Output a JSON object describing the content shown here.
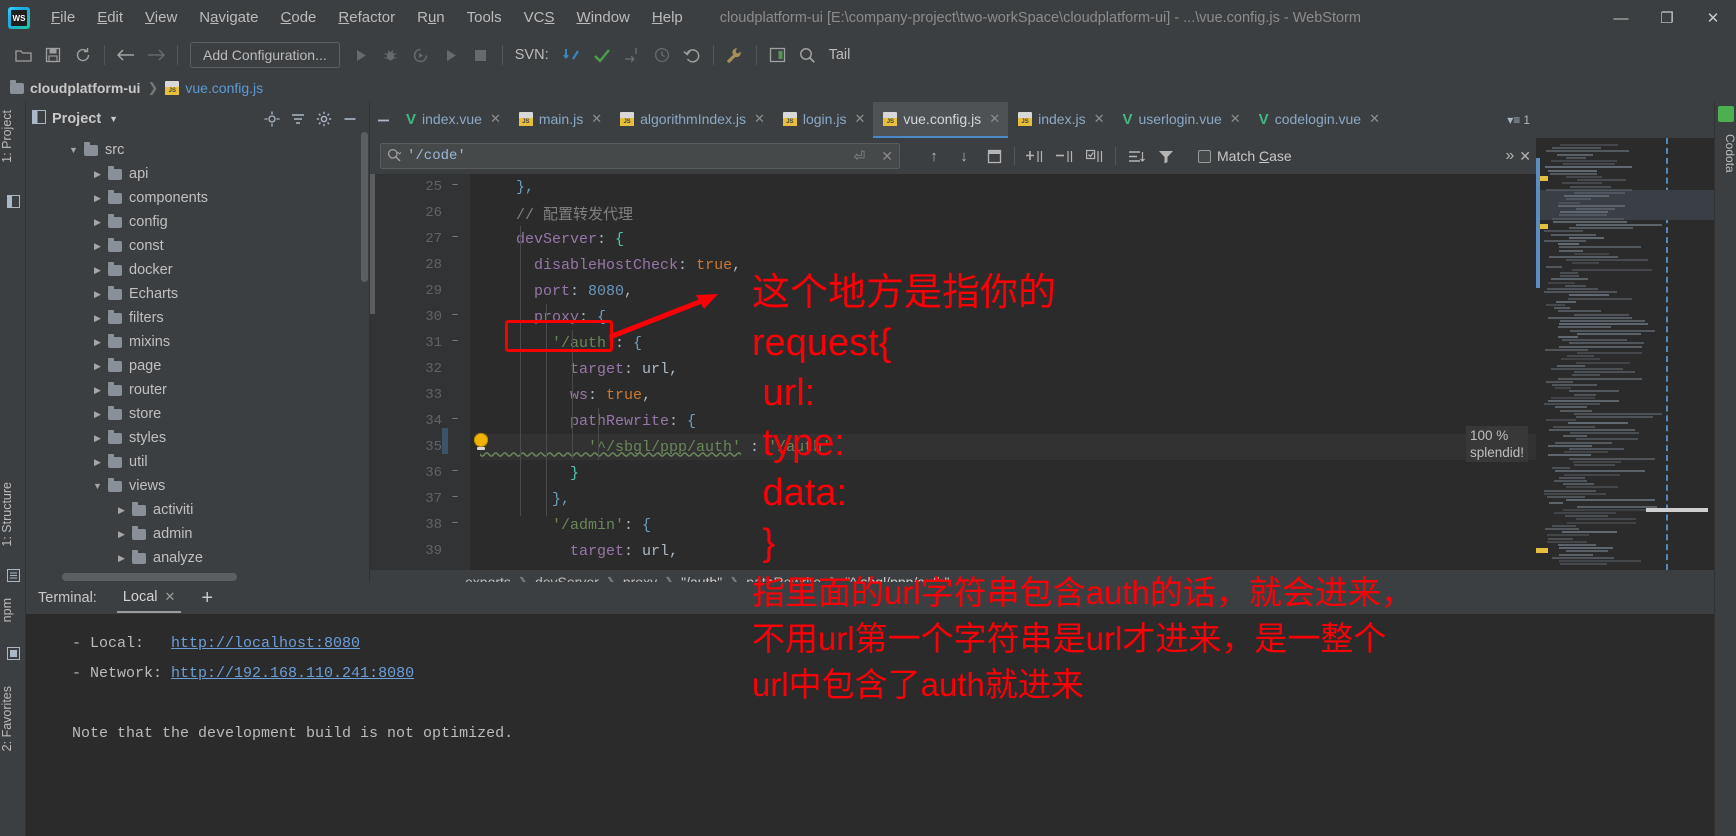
{
  "window": {
    "title": "cloudplatform-ui [E:\\company-project\\two-workSpace\\cloudplatform-ui] - ...\\vue.config.js - WebStorm",
    "minimize": "—",
    "maximize": "❐",
    "close": "✕"
  },
  "menu": [
    {
      "label": "File"
    },
    {
      "label": "Edit"
    },
    {
      "label": "View"
    },
    {
      "label": "Navigate"
    },
    {
      "label": "Code"
    },
    {
      "label": "Refactor"
    },
    {
      "label": "Run"
    },
    {
      "label": "Tools"
    },
    {
      "label": "VCS"
    },
    {
      "label": "Window"
    },
    {
      "label": "Help"
    }
  ],
  "toolbar": {
    "add_configuration": "Add Configuration...",
    "svn_label": "SVN:",
    "tail_label": "Tail"
  },
  "pathbar": {
    "project": "cloudplatform-ui",
    "file": "vue.config.js",
    "separator": "❯"
  },
  "left_strip": {
    "project_tab": "1: Project",
    "structure_tab": "1: Structure",
    "npm_tab": "npm",
    "favorites_tab": "2: Favorites"
  },
  "right_strip": {
    "codota_tab": "Codota"
  },
  "project_panel": {
    "title": "Project",
    "tree": [
      {
        "label": "src",
        "depth": 1,
        "twisty": "open",
        "type": "folder"
      },
      {
        "label": "api",
        "depth": 2,
        "twisty": "closed",
        "type": "folder"
      },
      {
        "label": "components",
        "depth": 2,
        "twisty": "closed",
        "type": "folder"
      },
      {
        "label": "config",
        "depth": 2,
        "twisty": "closed",
        "type": "folder"
      },
      {
        "label": "const",
        "depth": 2,
        "twisty": "closed",
        "type": "folder"
      },
      {
        "label": "docker",
        "depth": 2,
        "twisty": "closed",
        "type": "folder"
      },
      {
        "label": "Echarts",
        "depth": 2,
        "twisty": "closed",
        "type": "folder"
      },
      {
        "label": "filters",
        "depth": 2,
        "twisty": "closed",
        "type": "folder"
      },
      {
        "label": "mixins",
        "depth": 2,
        "twisty": "closed",
        "type": "folder"
      },
      {
        "label": "page",
        "depth": 2,
        "twisty": "closed",
        "type": "folder"
      },
      {
        "label": "router",
        "depth": 2,
        "twisty": "closed",
        "type": "folder"
      },
      {
        "label": "store",
        "depth": 2,
        "twisty": "closed",
        "type": "folder"
      },
      {
        "label": "styles",
        "depth": 2,
        "twisty": "closed",
        "type": "folder"
      },
      {
        "label": "util",
        "depth": 2,
        "twisty": "closed",
        "type": "folder"
      },
      {
        "label": "views",
        "depth": 2,
        "twisty": "open",
        "type": "folder"
      },
      {
        "label": "activiti",
        "depth": 3,
        "twisty": "closed",
        "type": "folder"
      },
      {
        "label": "admin",
        "depth": 3,
        "twisty": "closed",
        "type": "folder"
      },
      {
        "label": "analyze",
        "depth": 3,
        "twisty": "closed",
        "type": "folder"
      }
    ]
  },
  "tabs": [
    {
      "label": "index.vue",
      "icon": "vue-icon",
      "active": false
    },
    {
      "label": "main.js",
      "icon": "js-icon",
      "active": false
    },
    {
      "label": "algorithmIndex.js",
      "icon": "js-icon",
      "active": false
    },
    {
      "label": "login.js",
      "icon": "js-icon",
      "active": false
    },
    {
      "label": "vue.config.js",
      "icon": "js-icon",
      "active": true
    },
    {
      "label": "index.js",
      "icon": "js-icon",
      "active": false
    },
    {
      "label": "userlogin.vue",
      "icon": "vue-icon",
      "active": false
    },
    {
      "label": "codelogin.vue",
      "icon": "vue-icon",
      "active": false
    }
  ],
  "tab_overflow": "1",
  "find": {
    "value": "'/code'",
    "placeholder": "Search",
    "match_case_label": "Match Case",
    "match_case_checked": false,
    "more_label": "»"
  },
  "editor": {
    "first_line": 25,
    "highlight_line": 35,
    "tooltip": {
      "percent": "100 %",
      "word": "splendid!"
    },
    "lines": [
      {
        "n": 25,
        "fold": "−",
        "tokens": [
          {
            "t": "    },",
            "c": "k-brace1"
          }
        ]
      },
      {
        "n": 26,
        "fold": "",
        "tokens": [
          {
            "t": "    // 配置转发代理",
            "c": "k-comment"
          }
        ]
      },
      {
        "n": 27,
        "fold": "−",
        "tokens": [
          {
            "t": "    devServer",
            "c": "k-key"
          },
          {
            "t": ": ",
            "c": "k-punc"
          },
          {
            "t": "{",
            "c": "k-brace2"
          }
        ]
      },
      {
        "n": 28,
        "fold": "",
        "tokens": [
          {
            "t": "      disableHostCheck",
            "c": "k-key"
          },
          {
            "t": ": ",
            "c": "k-punc"
          },
          {
            "t": "true",
            "c": "k-bool"
          },
          {
            "t": ",",
            "c": "k-punc"
          }
        ]
      },
      {
        "n": 29,
        "fold": "",
        "tokens": [
          {
            "t": "      port",
            "c": "k-key"
          },
          {
            "t": ": ",
            "c": "k-punc"
          },
          {
            "t": "8080",
            "c": "k-num"
          },
          {
            "t": ",",
            "c": "k-punc"
          }
        ]
      },
      {
        "n": 30,
        "fold": "−",
        "tokens": [
          {
            "t": "      proxy",
            "c": "k-key"
          },
          {
            "t": ": ",
            "c": "k-punc"
          },
          {
            "t": "{",
            "c": "k-brace1"
          }
        ]
      },
      {
        "n": 31,
        "fold": "−",
        "tokens": [
          {
            "t": "        '/auth'",
            "c": "k-str"
          },
          {
            "t": ": ",
            "c": "k-punc"
          },
          {
            "t": "{",
            "c": "k-brace1"
          }
        ]
      },
      {
        "n": 32,
        "fold": "",
        "tokens": [
          {
            "t": "          target",
            "c": "k-key"
          },
          {
            "t": ": ",
            "c": "k-punc"
          },
          {
            "t": "url",
            "c": "k-plain"
          },
          {
            "t": ",",
            "c": "k-punc"
          }
        ]
      },
      {
        "n": 33,
        "fold": "",
        "tokens": [
          {
            "t": "          ws",
            "c": "k-key"
          },
          {
            "t": ": ",
            "c": "k-punc"
          },
          {
            "t": "true",
            "c": "k-bool"
          },
          {
            "t": ",",
            "c": "k-punc"
          }
        ]
      },
      {
        "n": 34,
        "fold": "−",
        "tokens": [
          {
            "t": "          pathRewrite",
            "c": "k-key"
          },
          {
            "t": ": ",
            "c": "k-punc"
          },
          {
            "t": "{",
            "c": "k-brace1"
          }
        ]
      },
      {
        "n": 35,
        "fold": "",
        "tokens": [
          {
            "t": "            '^/sbgl/ppp/auth'",
            "c": "k-str"
          },
          {
            "t": " : ",
            "c": "k-punc"
          },
          {
            "t": "'/auth'",
            "c": "k-str"
          }
        ]
      },
      {
        "n": 36,
        "fold": "−",
        "tokens": [
          {
            "t": "          }",
            "c": "k-brace2"
          }
        ]
      },
      {
        "n": 37,
        "fold": "−",
        "tokens": [
          {
            "t": "        },",
            "c": "k-brace1"
          }
        ]
      },
      {
        "n": 38,
        "fold": "−",
        "tokens": [
          {
            "t": "        '/admin'",
            "c": "k-str"
          },
          {
            "t": ": ",
            "c": "k-punc"
          },
          {
            "t": "{",
            "c": "k-brace1"
          }
        ]
      },
      {
        "n": 39,
        "fold": "",
        "tokens": [
          {
            "t": "          target",
            "c": "k-key"
          },
          {
            "t": ": ",
            "c": "k-punc"
          },
          {
            "t": "url",
            "c": "k-plain"
          },
          {
            "t": ",",
            "c": "k-punc"
          }
        ]
      }
    ]
  },
  "editor_crumbs": [
    {
      "label": "exports"
    },
    {
      "label": "devServer"
    },
    {
      "label": "proxy"
    },
    {
      "label": "\"/auth\""
    },
    {
      "label": "pathRewrite"
    },
    {
      "label": "\"^/sbgl/ppp/auth\""
    }
  ],
  "terminal": {
    "title": "Terminal:",
    "tab": "Local",
    "add": "+",
    "lines": [
      {
        "prefix": "  - Local:   ",
        "link": "http://localhost:8080"
      },
      {
        "prefix": "  - Network: ",
        "link": "http://192.168.110.241:8080"
      },
      {
        "prefix": "",
        "link": ""
      },
      {
        "prefix": "  Note that the development build is not optimized.",
        "link": ""
      }
    ]
  },
  "annotations": {
    "top": [
      "这个地方是指你的",
      "request{",
      " url:",
      " type:",
      " data:",
      " }"
    ],
    "bottom": [
      "指里面的url字符串包含auth的话，就会进来，",
      "不用url第一个字符串是url才进来，是一整个",
      "url中包含了auth就进来"
    ]
  },
  "colors": {
    "annotation_red": "#fb0007",
    "accent_blue": "#4a88c7",
    "vue_green": "#41b883",
    "js_yellow": "#e8bf3d",
    "editor_bg": "#2b2b2b",
    "chrome_bg": "#3c3f41"
  }
}
